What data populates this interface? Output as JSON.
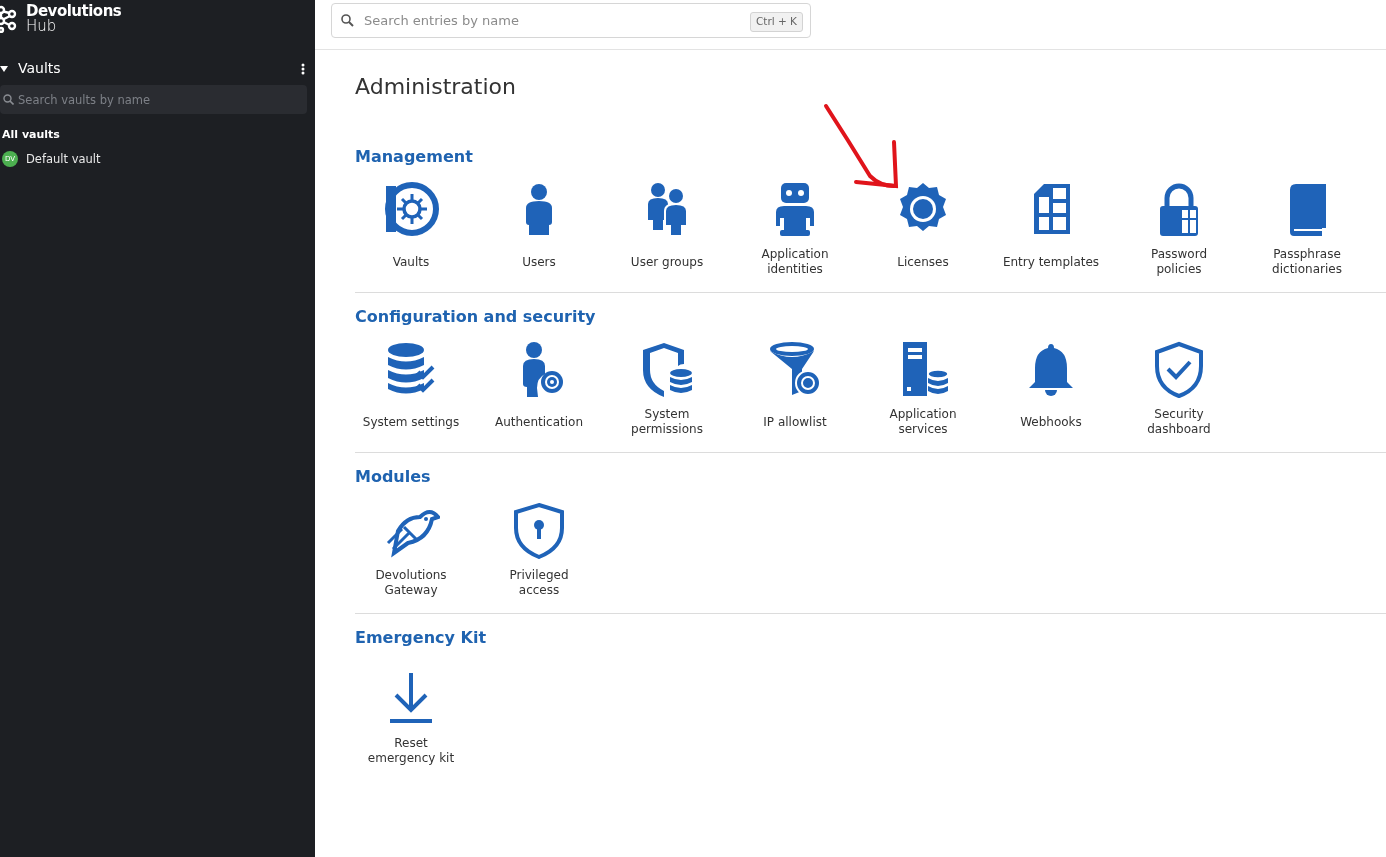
{
  "sidebar": {
    "logo": {
      "brand": "Devolutions",
      "product": "Hub"
    },
    "section": {
      "title": "Vaults",
      "expanded": true
    },
    "search": {
      "placeholder": "Search vaults by name"
    },
    "group_label": "All vaults",
    "vaults": [
      {
        "initials": "DV",
        "name": "Default vault",
        "color": "#4caf50"
      }
    ]
  },
  "top_search": {
    "placeholder": "Search entries by name",
    "shortcut": "Ctrl + K"
  },
  "page_title": "Administration",
  "sections": [
    {
      "title": "Management",
      "tiles": [
        {
          "label": "Vaults"
        },
        {
          "label": "Users"
        },
        {
          "label": "User groups"
        },
        {
          "label": "Application\nidentities"
        },
        {
          "label": "Licenses"
        },
        {
          "label": "Entry templates"
        },
        {
          "label": "Password\npolicies"
        },
        {
          "label": "Passphrase\ndictionaries"
        }
      ]
    },
    {
      "title": "Configuration and security",
      "tiles": [
        {
          "label": "System settings"
        },
        {
          "label": "Authentication"
        },
        {
          "label": "System\npermissions"
        },
        {
          "label": "IP allowlist"
        },
        {
          "label": "Application\nservices"
        },
        {
          "label": "Webhooks"
        },
        {
          "label": "Security\ndashboard"
        }
      ]
    },
    {
      "title": "Modules",
      "tiles": [
        {
          "label": "Devolutions\nGateway"
        },
        {
          "label": "Privileged\naccess"
        }
      ]
    },
    {
      "title": "Emergency Kit",
      "tiles": [
        {
          "label": "Reset\nemergency kit"
        }
      ]
    }
  ]
}
